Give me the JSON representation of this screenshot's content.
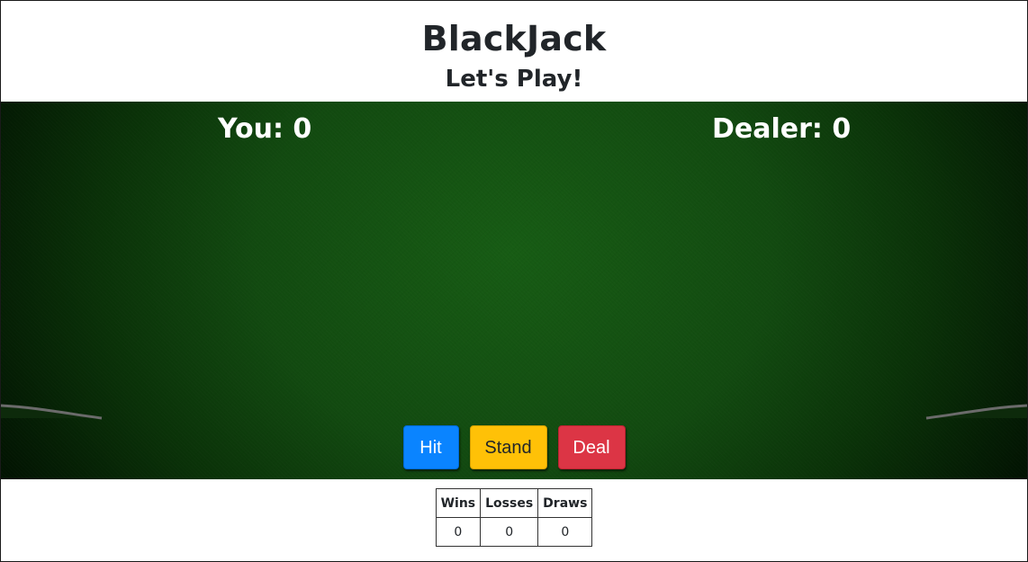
{
  "header": {
    "title": "BlackJack",
    "subtitle": "Let's Play!"
  },
  "scores": {
    "you_label": "You: 0",
    "dealer_label": "Dealer: 0"
  },
  "controls": {
    "hit_label": "Hit",
    "stand_label": "Stand",
    "deal_label": "Deal"
  },
  "stats": {
    "headers": [
      "Wins",
      "Losses",
      "Draws"
    ],
    "values": [
      "0",
      "0",
      "0"
    ]
  },
  "colors": {
    "felt": "#124a10",
    "hit": "#0a84ff",
    "stand": "#ffc107",
    "deal": "#dc3545"
  }
}
